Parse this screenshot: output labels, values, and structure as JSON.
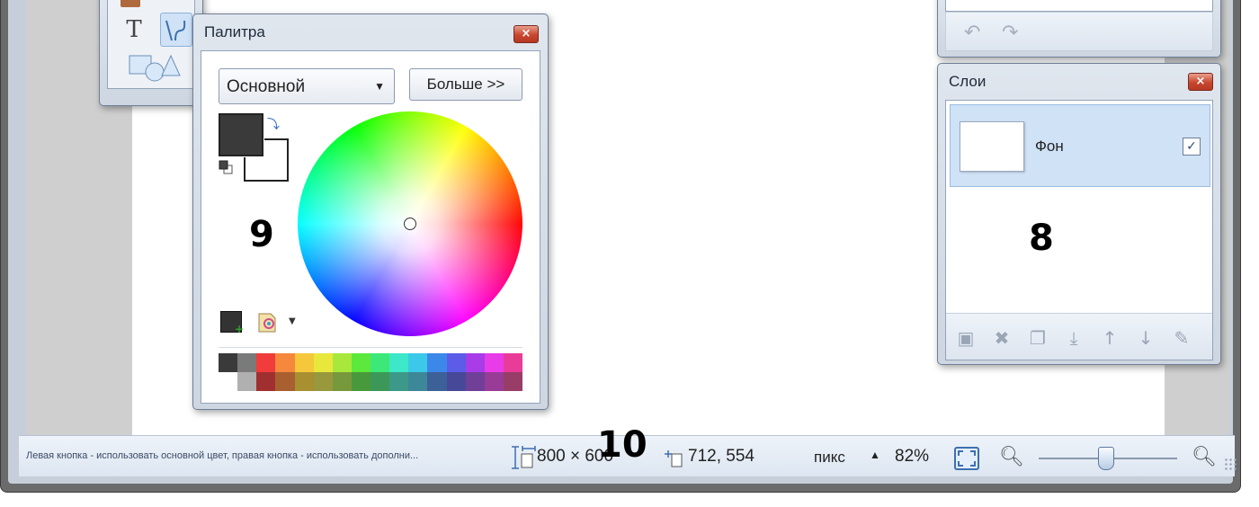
{
  "palette": {
    "title": "Палитра",
    "close_glyph": "×",
    "mode_select": "Основной",
    "more_button": "Больше >>",
    "primary_color": "#3a3a3a",
    "secondary_color": "#ffffff",
    "swatches_top": [
      "#3a3a3a",
      "#7a7a7a",
      "#f03c3c",
      "#f5883c",
      "#f5c83c",
      "#e8e83c",
      "#a8e83c",
      "#5ce83c",
      "#3ce878",
      "#3ce8c8",
      "#3cc8e8",
      "#3c88e8",
      "#5c5ce8",
      "#a83ce8",
      "#e83ce8",
      "#e83c98"
    ],
    "swatches_bottom": [
      "#ffffff",
      "#b0b0b0",
      "#a03030",
      "#a86030",
      "#a89030",
      "#98983c",
      "#78983c",
      "#48983c",
      "#3c9858",
      "#3c9888",
      "#3c8898",
      "#3c6098",
      "#484898",
      "#704098",
      "#983c98",
      "#983c68"
    ]
  },
  "layers": {
    "title": "Слои",
    "close_glyph": "×",
    "items": [
      {
        "name": "Фон",
        "visible_check": "✓"
      }
    ],
    "toolbar_icons": [
      "add-layer-icon",
      "delete-layer-icon",
      "duplicate-layer-icon",
      "merge-layer-down-icon",
      "move-layer-up-icon",
      "move-layer-down-icon",
      "layer-properties-icon"
    ]
  },
  "statusbar": {
    "hint": "Левая кнопка - использовать основной цвет, правая кнопка - использовать дополни...",
    "image_size": "800 × 600",
    "cursor_position": "712, 554",
    "units": "пикс",
    "zoom": "82%"
  },
  "annotations": {
    "palette_number": "9",
    "layers_number": "8",
    "statusbar_number": "10"
  },
  "colors": {
    "accent": "#3d6fb0",
    "close_button": "#c9452e",
    "selected_layer": "#cfe2f6"
  }
}
